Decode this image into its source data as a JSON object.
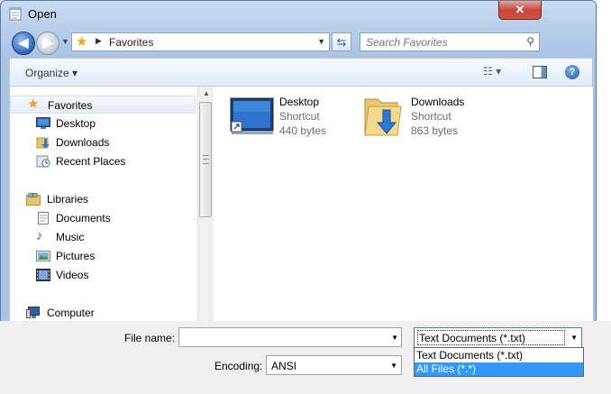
{
  "window": {
    "title": "Open",
    "close_label": "✕"
  },
  "nav": {
    "back_glyph": "◀",
    "forward_glyph": "▶"
  },
  "address": {
    "crumb": "Favorites"
  },
  "search": {
    "placeholder": "Search Favorites"
  },
  "toolbar": {
    "organize_label": "Organize ▾",
    "help_glyph": "?"
  },
  "sidebar": {
    "items": [
      {
        "label": "Favorites",
        "icon": "star-icon"
      },
      {
        "label": "Desktop",
        "icon": "desktop-icon"
      },
      {
        "label": "Downloads",
        "icon": "downloads-icon"
      },
      {
        "label": "Recent Places",
        "icon": "recent-places-icon"
      },
      {
        "label": "Libraries",
        "icon": "libraries-icon"
      },
      {
        "label": "Documents",
        "icon": "documents-icon"
      },
      {
        "label": "Music",
        "icon": "music-icon"
      },
      {
        "label": "Pictures",
        "icon": "pictures-icon"
      },
      {
        "label": "Videos",
        "icon": "videos-icon"
      },
      {
        "label": "Computer",
        "icon": "computer-icon"
      }
    ]
  },
  "files": [
    {
      "name": "Desktop",
      "type": "Shortcut",
      "size": "440 bytes",
      "icon": "desktop-shortcut-icon"
    },
    {
      "name": "Downloads",
      "type": "Shortcut",
      "size": "863 bytes",
      "icon": "downloads-folder-icon"
    }
  ],
  "bottom": {
    "file_name_label": "File name:",
    "file_name_value": "",
    "file_type_value": "Text Documents (*.txt)",
    "encoding_label": "Encoding:",
    "encoding_value": "ANSI"
  },
  "file_type_options": [
    "Text Documents (*.txt)",
    "All Files  (*.*)"
  ],
  "colors": {
    "selection": "#3399ff",
    "window_frame": "#aac4e6",
    "close_button": "#c6463a"
  }
}
